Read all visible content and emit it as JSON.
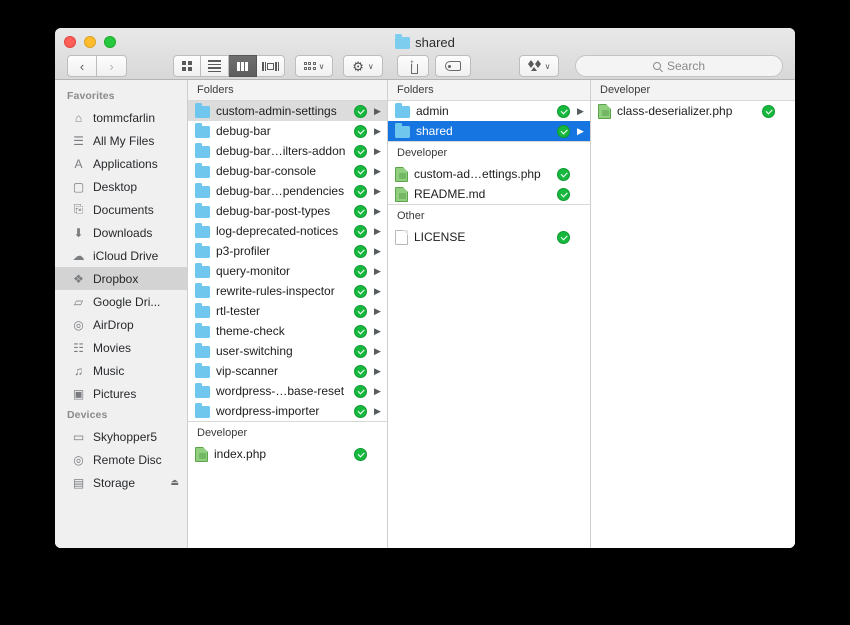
{
  "window": {
    "title": "shared",
    "title_icon": "folder-icon",
    "traffic_lights": [
      {
        "name": "close-button",
        "color": "#ff5f57"
      },
      {
        "name": "minimize-button",
        "color": "#ffbd2e"
      },
      {
        "name": "zoom-button",
        "color": "#28c940"
      }
    ]
  },
  "toolbar": {
    "back_label": "‹",
    "forward_label": "›",
    "view_modes": [
      {
        "name": "icon-view-button",
        "icon": "grid-icon",
        "active": false
      },
      {
        "name": "list-view-button",
        "icon": "list-icon",
        "active": false
      },
      {
        "name": "column-view-button",
        "icon": "columns-icon",
        "active": true
      },
      {
        "name": "coverflow-view-button",
        "icon": "coverflow-icon",
        "active": false
      }
    ],
    "arrange_icon": "arrange-icon",
    "gear_icon": "gear-icon",
    "gear_glyph": "⚙",
    "share_icon": "share-icon",
    "tag_icon": "tag-icon",
    "dropbox_icon": "dropbox-icon",
    "chevron_glyph": "∨"
  },
  "search": {
    "placeholder": "Search",
    "value": "",
    "icon": "search-icon"
  },
  "sidebar": {
    "sections": [
      {
        "header": "Favorites",
        "items": [
          {
            "label": "tommcfarlin",
            "icon": "home-icon",
            "glyph": "⌂",
            "selected": false,
            "eject": false
          },
          {
            "label": "All My Files",
            "icon": "all-my-files-icon",
            "glyph": "☰",
            "selected": false,
            "eject": false
          },
          {
            "label": "Applications",
            "icon": "applications-icon",
            "glyph": "A",
            "selected": false,
            "eject": false
          },
          {
            "label": "Desktop",
            "icon": "desktop-icon",
            "glyph": "▢",
            "selected": false,
            "eject": false
          },
          {
            "label": "Documents",
            "icon": "documents-icon",
            "glyph": "⎘",
            "selected": false,
            "eject": false
          },
          {
            "label": "Downloads",
            "icon": "downloads-icon",
            "glyph": "⬇",
            "selected": false,
            "eject": false
          },
          {
            "label": "iCloud Drive",
            "icon": "icloud-icon",
            "glyph": "☁",
            "selected": false,
            "eject": false
          },
          {
            "label": "Dropbox",
            "icon": "dropbox-icon",
            "glyph": "❖",
            "selected": true,
            "eject": false
          },
          {
            "label": "Google Dri...",
            "icon": "folder-icon",
            "glyph": "▱",
            "selected": false,
            "eject": false
          },
          {
            "label": "AirDrop",
            "icon": "airdrop-icon",
            "glyph": "◎",
            "selected": false,
            "eject": false
          },
          {
            "label": "Movies",
            "icon": "movies-icon",
            "glyph": "☷",
            "selected": false,
            "eject": false
          },
          {
            "label": "Music",
            "icon": "music-icon",
            "glyph": "♫",
            "selected": false,
            "eject": false
          },
          {
            "label": "Pictures",
            "icon": "pictures-icon",
            "glyph": "▣",
            "selected": false,
            "eject": false
          }
        ]
      },
      {
        "header": "Devices",
        "items": [
          {
            "label": "Skyhopper5",
            "icon": "laptop-icon",
            "glyph": "▭",
            "selected": false,
            "eject": false
          },
          {
            "label": "Remote Disc",
            "icon": "disc-icon",
            "glyph": "◎",
            "selected": false,
            "eject": false
          },
          {
            "label": "Storage",
            "icon": "drive-icon",
            "glyph": "▤",
            "selected": false,
            "eject": true
          }
        ]
      }
    ],
    "eject_glyph": "⏏"
  },
  "columns": [
    {
      "name": "column-1",
      "header": "Folders",
      "groups": [
        {
          "header": null,
          "items": [
            {
              "label": "custom-admin-settings",
              "icon": "folder-icon",
              "kind": "folder",
              "badge": true,
              "chevron": true,
              "state": "highlighted"
            },
            {
              "label": "debug-bar",
              "icon": "folder-icon",
              "kind": "folder",
              "badge": true,
              "chevron": true,
              "state": "normal"
            },
            {
              "label": "debug-bar…ilters-addon",
              "icon": "folder-icon",
              "kind": "folder",
              "badge": true,
              "chevron": true,
              "state": "normal"
            },
            {
              "label": "debug-bar-console",
              "icon": "folder-icon",
              "kind": "folder",
              "badge": true,
              "chevron": true,
              "state": "normal"
            },
            {
              "label": "debug-bar…pendencies",
              "icon": "folder-icon",
              "kind": "folder",
              "badge": true,
              "chevron": true,
              "state": "normal"
            },
            {
              "label": "debug-bar-post-types",
              "icon": "folder-icon",
              "kind": "folder",
              "badge": true,
              "chevron": true,
              "state": "normal"
            },
            {
              "label": "log-deprecated-notices",
              "icon": "folder-icon",
              "kind": "folder",
              "badge": true,
              "chevron": true,
              "state": "normal"
            },
            {
              "label": "p3-profiler",
              "icon": "folder-icon",
              "kind": "folder",
              "badge": true,
              "chevron": true,
              "state": "normal"
            },
            {
              "label": "query-monitor",
              "icon": "folder-icon",
              "kind": "folder",
              "badge": true,
              "chevron": true,
              "state": "normal"
            },
            {
              "label": "rewrite-rules-inspector",
              "icon": "folder-icon",
              "kind": "folder",
              "badge": true,
              "chevron": true,
              "state": "normal"
            },
            {
              "label": "rtl-tester",
              "icon": "folder-icon",
              "kind": "folder",
              "badge": true,
              "chevron": true,
              "state": "normal"
            },
            {
              "label": "theme-check",
              "icon": "folder-icon",
              "kind": "folder",
              "badge": true,
              "chevron": true,
              "state": "normal"
            },
            {
              "label": "user-switching",
              "icon": "folder-icon",
              "kind": "folder",
              "badge": true,
              "chevron": true,
              "state": "normal"
            },
            {
              "label": "vip-scanner",
              "icon": "folder-icon",
              "kind": "folder",
              "badge": true,
              "chevron": true,
              "state": "normal"
            },
            {
              "label": "wordpress-…base-reset",
              "icon": "folder-icon",
              "kind": "folder",
              "badge": true,
              "chevron": true,
              "state": "normal"
            },
            {
              "label": "wordpress-importer",
              "icon": "folder-icon",
              "kind": "folder",
              "badge": true,
              "chevron": true,
              "state": "normal"
            }
          ]
        },
        {
          "header": "Developer",
          "items": [
            {
              "label": "index.php",
              "icon": "php-file-icon",
              "kind": "php",
              "badge": true,
              "chevron": false,
              "state": "normal"
            }
          ]
        }
      ]
    },
    {
      "name": "column-2",
      "header": "Folders",
      "groups": [
        {
          "header": null,
          "items": [
            {
              "label": "admin",
              "icon": "folder-icon",
              "kind": "folder",
              "badge": true,
              "chevron": true,
              "state": "normal"
            },
            {
              "label": "shared",
              "icon": "folder-icon",
              "kind": "folder",
              "badge": true,
              "chevron": true,
              "state": "selected"
            }
          ]
        },
        {
          "header": "Developer",
          "items": [
            {
              "label": "custom-ad…ettings.php",
              "icon": "php-file-icon",
              "kind": "php",
              "badge": true,
              "chevron": false,
              "state": "normal"
            },
            {
              "label": "README.md",
              "icon": "php-file-icon",
              "kind": "php",
              "badge": true,
              "chevron": false,
              "state": "normal"
            }
          ]
        },
        {
          "header": "Other",
          "items": [
            {
              "label": "LICENSE",
              "icon": "document-icon",
              "kind": "doc",
              "badge": true,
              "chevron": false,
              "state": "normal"
            }
          ]
        }
      ]
    },
    {
      "name": "column-3",
      "header": "Developer",
      "groups": [
        {
          "header": null,
          "items": [
            {
              "label": "class-deserializer.php",
              "icon": "php-file-icon",
              "kind": "php",
              "badge": true,
              "chevron": false,
              "state": "normal"
            }
          ]
        }
      ]
    }
  ],
  "colors": {
    "selection_blue": "#1675e0",
    "sync_badge_green": "#16b83e",
    "folder_blue": "#6fc7ee",
    "sidebar_bg": "#f0f0f1"
  }
}
